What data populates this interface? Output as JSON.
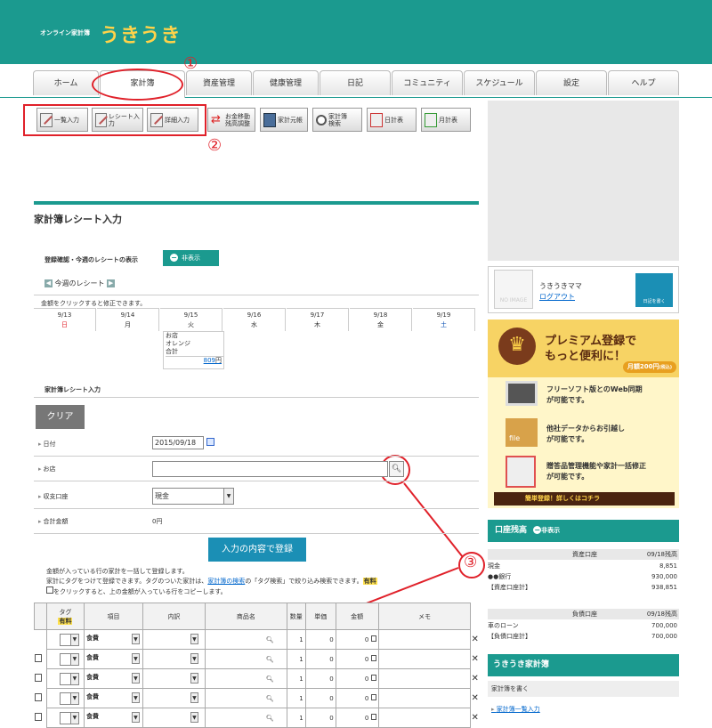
{
  "header": {
    "subtitle": "オンライン家計簿",
    "title": "うきうき"
  },
  "tabs": [
    "ホーム",
    "家計簿",
    "資産管理",
    "健康管理",
    "日記",
    "コミュニティ",
    "スケジュール",
    "設定",
    "ヘルプ"
  ],
  "toolbar": {
    "ichiran": "一覧入力",
    "receipt": "レシート入力",
    "shousai": "詳細入力",
    "idou1": "お金移動",
    "idou2": "残高調整",
    "motocho": "家計元帳",
    "kensaku1": "家計簿",
    "kensaku2": "検索",
    "nikkei": "日計表",
    "gekkei": "月計表"
  },
  "annotations": [
    "①",
    "②",
    "③"
  ],
  "page_title": "家計簿レシート入力",
  "register": {
    "label": "登録確認・今週のレシートの表示",
    "hide_button": "非表示"
  },
  "week": {
    "nav_label": "今週のレシート",
    "note": "金額をクリックすると修正できます。",
    "days": [
      {
        "date": "9/13",
        "dow": "日",
        "color": "#e0212a"
      },
      {
        "date": "9/14",
        "dow": "月",
        "color": "#333"
      },
      {
        "date": "9/15",
        "dow": "火",
        "color": "#333"
      },
      {
        "date": "9/16",
        "dow": "水",
        "color": "#333"
      },
      {
        "date": "9/17",
        "dow": "木",
        "color": "#333"
      },
      {
        "date": "9/18",
        "dow": "金",
        "color": "#333"
      },
      {
        "date": "9/19",
        "dow": "土",
        "color": "#0a4fb3"
      }
    ],
    "receipt": {
      "shop_label": "お店",
      "shop": "オレンジ",
      "total_label": "合計",
      "amount": "809",
      "unit": "円"
    }
  },
  "form": {
    "title": "家計簿レシート入力",
    "clear": "クリア",
    "date_label": "日付",
    "date_value": "2015/09/18",
    "shop_label": "お店",
    "account_label": "収支口座",
    "account_value": "現金",
    "total_label": "合計金額",
    "total_value": "0円",
    "submit": "入力の内容で登録"
  },
  "notes": {
    "line1": "金額が入っている行の家計を一括して登録します。",
    "line2a": "家計にタグをつけて登録できます。タグのついた家計は、",
    "line2_link": "家計簿の検索",
    "line2b": "の「タグ検索」で絞り込み検索できます。",
    "paid": "有料",
    "line3": "をクリックすると、上の金額が入っている行をコピーします。"
  },
  "grid": {
    "headers": {
      "tag": "タグ",
      "paid": "有料",
      "item": "項目",
      "detail": "内訳",
      "product": "商品名",
      "qty": "数量",
      "unit": "単価",
      "amount": "金額",
      "memo": "メモ"
    },
    "rows": [
      {
        "item": "食費",
        "qty": "1",
        "unit": "0",
        "amount": "0"
      },
      {
        "item": "食費",
        "qty": "1",
        "unit": "0",
        "amount": "0"
      },
      {
        "item": "食費",
        "qty": "1",
        "unit": "0",
        "amount": "0"
      },
      {
        "item": "食費",
        "qty": "1",
        "unit": "0",
        "amount": "0"
      },
      {
        "item": "食費",
        "qty": "1",
        "unit": "0",
        "amount": "0"
      }
    ],
    "delete": "✕"
  },
  "sidebar": {
    "user": {
      "name": "うきうきママ",
      "logout": "ログアウト",
      "avatar": "NO IMAGE",
      "diary": "日記を書く"
    },
    "premium": {
      "line1": "プレミアム登録で",
      "line2": "もっと便利に！",
      "price": "月額200円",
      "tax": "(税込)",
      "f1a": "フリーソフト版とのWeb同期",
      "f1b": "が可能です。",
      "f2a": "他社データからお引越し",
      "f2b": "が可能です。",
      "f3a": "贈答品管理機能や家計一括修正",
      "f3b": "が可能です。",
      "cta": "簡単登録！詳しくはコチラ"
    },
    "accounts": {
      "title": "口座残高",
      "hide": "非表示",
      "asset_header": "資産口座",
      "asset_date": "09/18残高",
      "assets": [
        {
          "name": "現金",
          "value": "8,851"
        },
        {
          "name": "●●銀行",
          "value": "930,000"
        },
        {
          "name": "【資産口座計】",
          "value": "938,851"
        }
      ],
      "debt_header": "負債口座",
      "debt_date": "09/18残高",
      "debts": [
        {
          "name": "車のローン",
          "value": "700,000"
        },
        {
          "name": "【負債口座計】",
          "value": "700,000"
        }
      ]
    },
    "kakei": {
      "title": "うきうき家計簿",
      "write": "家計簿を書く",
      "link": "家計簿一覧入力"
    }
  }
}
